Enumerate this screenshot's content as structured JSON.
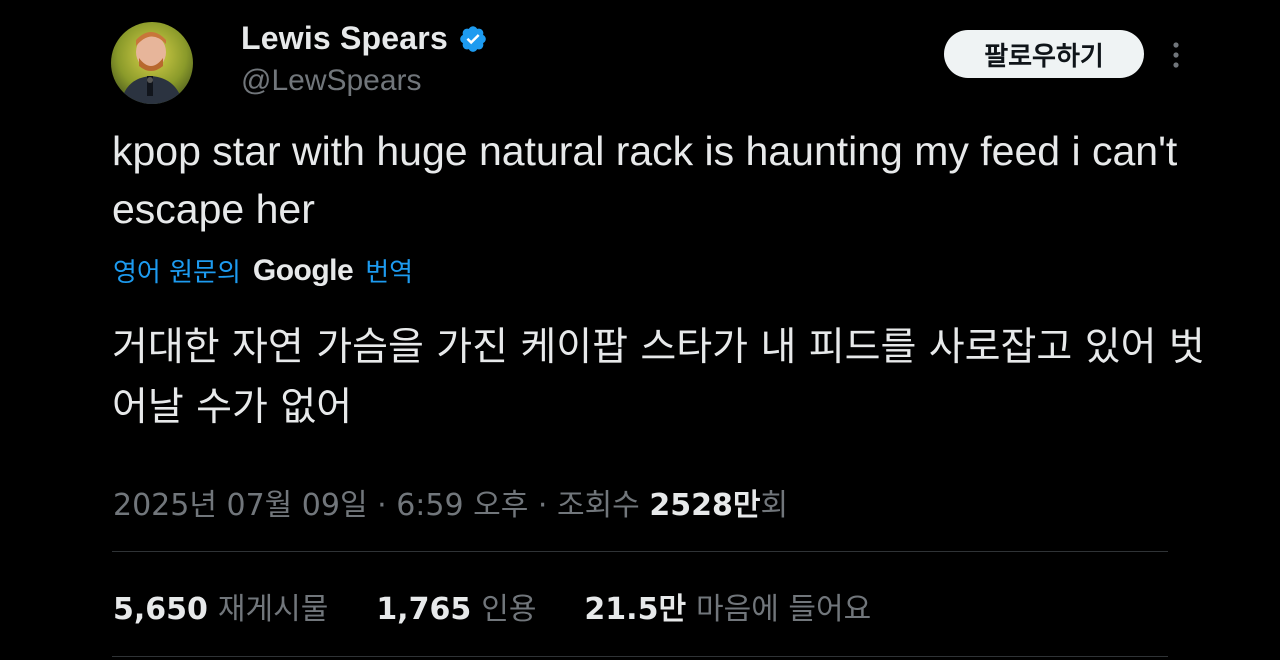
{
  "author": {
    "display_name": "Lewis Spears",
    "handle": "@LewSpears",
    "verified_icon": "verified-badge-icon",
    "avatar": "profile-photo"
  },
  "actions": {
    "follow_label": "팔로우하기",
    "more_icon": "more-vertical-icon"
  },
  "tweet": {
    "text": "kpop star with huge natural rack is haunting my feed i can't escape her",
    "translate_prefix": "영어 원문의",
    "translate_brand": "Google",
    "translate_suffix": "번역",
    "translated_text": "거대한 자연 가슴을 가진 케이팝 스타가 내 피드를 사로잡고 있어 벗어날 수가 없어"
  },
  "meta": {
    "date": "2025년 07월 09일",
    "separator": "·",
    "time": "6:59 오후",
    "views_label": "조회수",
    "views_count": "2528만",
    "views_suffix": "회"
  },
  "stats": [
    {
      "count": "5,650",
      "label": "재게시물"
    },
    {
      "count": "1,765",
      "label": "인용"
    },
    {
      "count": "21.5만",
      "label": "마음에 들어요"
    }
  ],
  "colors": {
    "background": "#000000",
    "text_primary": "#e7e9ea",
    "text_secondary": "#71767b",
    "accent": "#1d9bf0",
    "divider": "#2f3336"
  }
}
